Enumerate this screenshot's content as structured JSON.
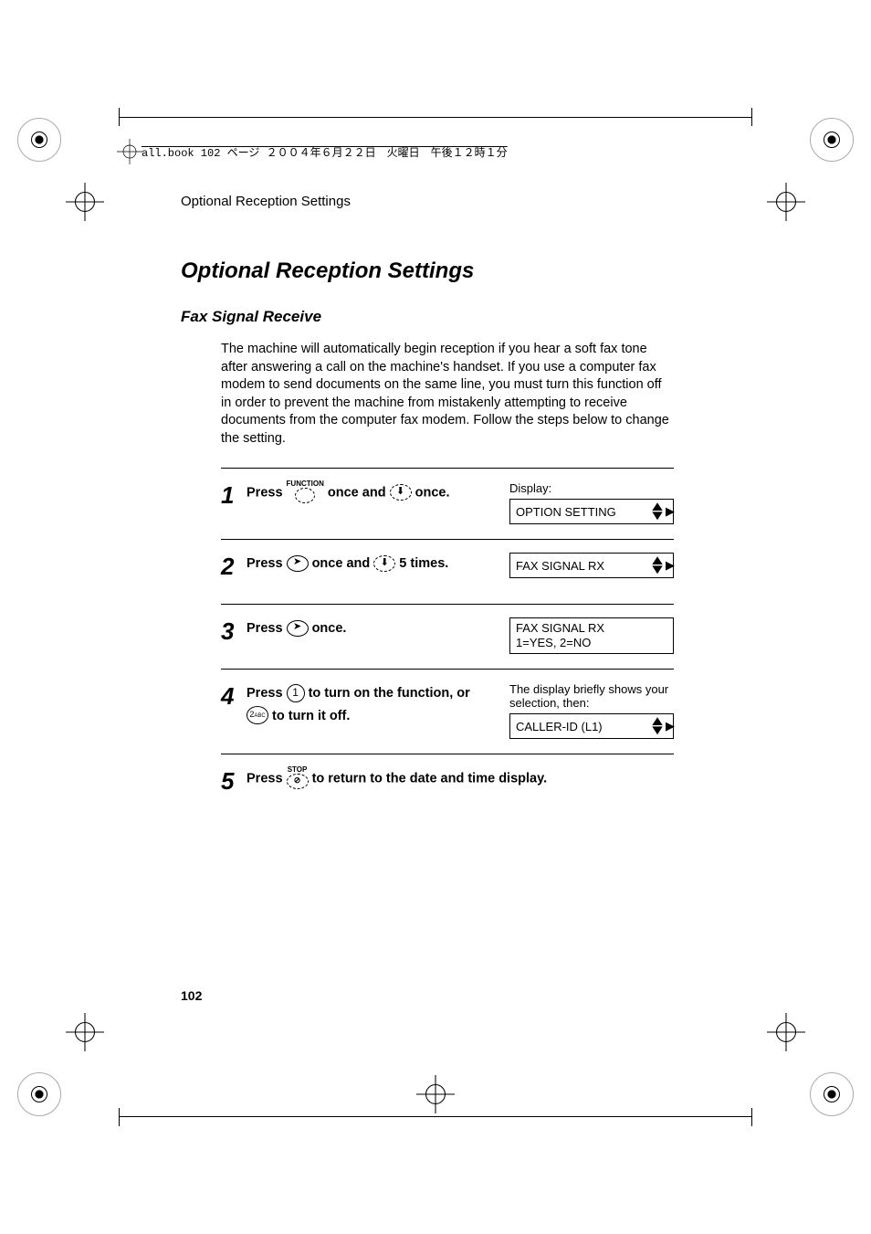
{
  "printmark": "all.book  102 ページ  ２００４年６月２２日　火曜日　午後１２時１分",
  "running_head": "Optional Reception Settings",
  "section_title": "Optional Reception Settings",
  "subsection_title": "Fax Signal Receive",
  "body_text": "The machine will automatically begin reception if you hear a soft fax tone after answering a call on the machine's handset. If you use a computer fax modem to send documents on the same line, you must turn this function off in order to prevent the machine from mistakenly attempting to receive documents from the computer fax modem. Follow the steps below to change the setting.",
  "steps": [
    {
      "num": "1",
      "instr_parts": {
        "a": "Press ",
        "b": " once and ",
        "c": " once."
      },
      "display_label": "Display:",
      "lcd": {
        "line1": "OPTION SETTING"
      }
    },
    {
      "num": "2",
      "instr_parts": {
        "a": "Press ",
        "b": " once and ",
        "c": " 5 times."
      },
      "lcd": {
        "line1": "FAX SIGNAL RX"
      }
    },
    {
      "num": "3",
      "instr_parts": {
        "a": "Press ",
        "b": " once."
      },
      "lcd": {
        "line1": "FAX SIGNAL RX",
        "line2": "1=YES, 2=NO"
      }
    },
    {
      "num": "4",
      "instr_parts": {
        "a": "Press ",
        "b": " to turn on the function, or ",
        "c": " to turn it off."
      },
      "key1": "1",
      "key2": "2",
      "key2_sub": "ABC",
      "display_note": "The display briefly shows your selection, then:",
      "lcd": {
        "line1": "CALLER-ID (L1)"
      }
    },
    {
      "num": "5",
      "instr_parts": {
        "a": "Press ",
        "b": " to return to the date and time display."
      }
    }
  ],
  "button_labels": {
    "function": "FUNCTION",
    "stop": "STOP"
  },
  "page_number": "102"
}
